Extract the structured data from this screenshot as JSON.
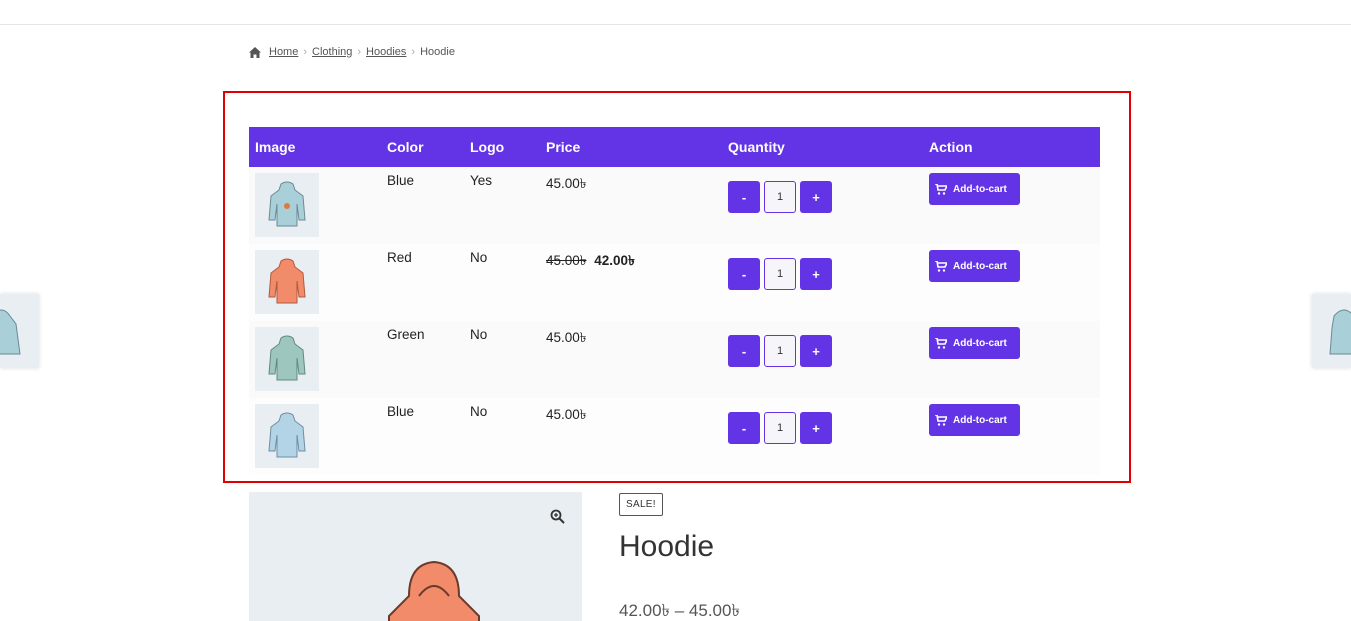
{
  "breadcrumb": {
    "home": "Home",
    "clothing": "Clothing",
    "hoodies": "Hoodies",
    "current": "Hoodie"
  },
  "table": {
    "headers": [
      "Image",
      "Color",
      "Logo",
      "Price",
      "Quantity",
      "Action"
    ],
    "rows": [
      {
        "color": "Blue",
        "logo": "Yes",
        "price": "45.00৳",
        "qty": "1",
        "hoodie_color": "#a9cfd8"
      },
      {
        "color": "Red",
        "logo": "No",
        "price_old": "45.00৳",
        "price_new": "42.00৳",
        "qty": "1",
        "hoodie_color": "#f28b6a"
      },
      {
        "color": "Green",
        "logo": "No",
        "price": "45.00৳",
        "qty": "1",
        "hoodie_color": "#9dc6bf"
      },
      {
        "color": "Blue",
        "logo": "No",
        "price": "45.00৳",
        "qty": "1",
        "hoodie_color": "#b3d3e6"
      }
    ],
    "minus_label": "-",
    "plus_label": "+",
    "cart_label": "Add-to-cart"
  },
  "product": {
    "sale_badge": "SALE!",
    "title": "Hoodie",
    "price_range": "42.00৳ – 45.00৳"
  },
  "colors": {
    "accent": "#6333e6",
    "highlight": "#e10000"
  },
  "icons": {
    "home": "home-icon",
    "cart": "cart-icon",
    "zoom": "zoom-in-icon"
  }
}
